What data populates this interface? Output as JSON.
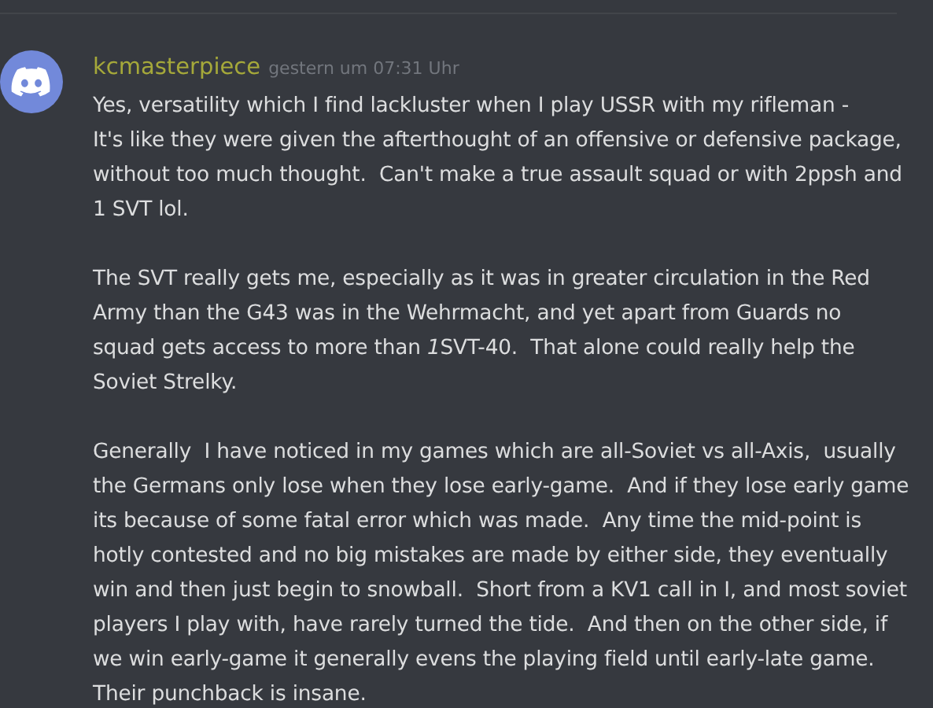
{
  "message": {
    "author": "kcmasterpiece",
    "timestamp": "gestern um 07:31 Uhr",
    "paragraphs": [
      [
        "Yes, versatility which I find lackluster when I play USSR with my rifleman -",
        "It's like they were given the afterthought of an offensive or defensive package,",
        "without too much thought.  Can't make a true assault squad or with 2ppsh and",
        "1 SVT lol."
      ],
      [
        "The SVT really gets me, especially as it was in greater circulation in the Red",
        "Army than the G43 was in the Wehrmacht, and yet apart from Guards no",
        [
          {
            "text": "squad gets access to more than ",
            "italic": false
          },
          {
            "text": "1",
            "italic": true
          },
          {
            "text": "SVT-40.  That alone could really help the",
            "italic": false
          }
        ],
        "Soviet Strelky."
      ],
      [
        "Generally  I have noticed in my games which are all-Soviet vs all-Axis,  usually",
        "the Germans only lose when they lose early-game.  And if they lose early game",
        "its because of some fatal error which was made.  Any time the mid-point is",
        "hotly contested and no big mistakes are made by either side, they eventually",
        "win and then just begin to snowball.  Short from a KV1 call in I, and most soviet",
        "players I play with, have rarely turned the tide.  And then on the other side, if",
        "we win early-game it generally evens the playing field until early-late game.",
        "Their punchback is insane."
      ]
    ]
  }
}
